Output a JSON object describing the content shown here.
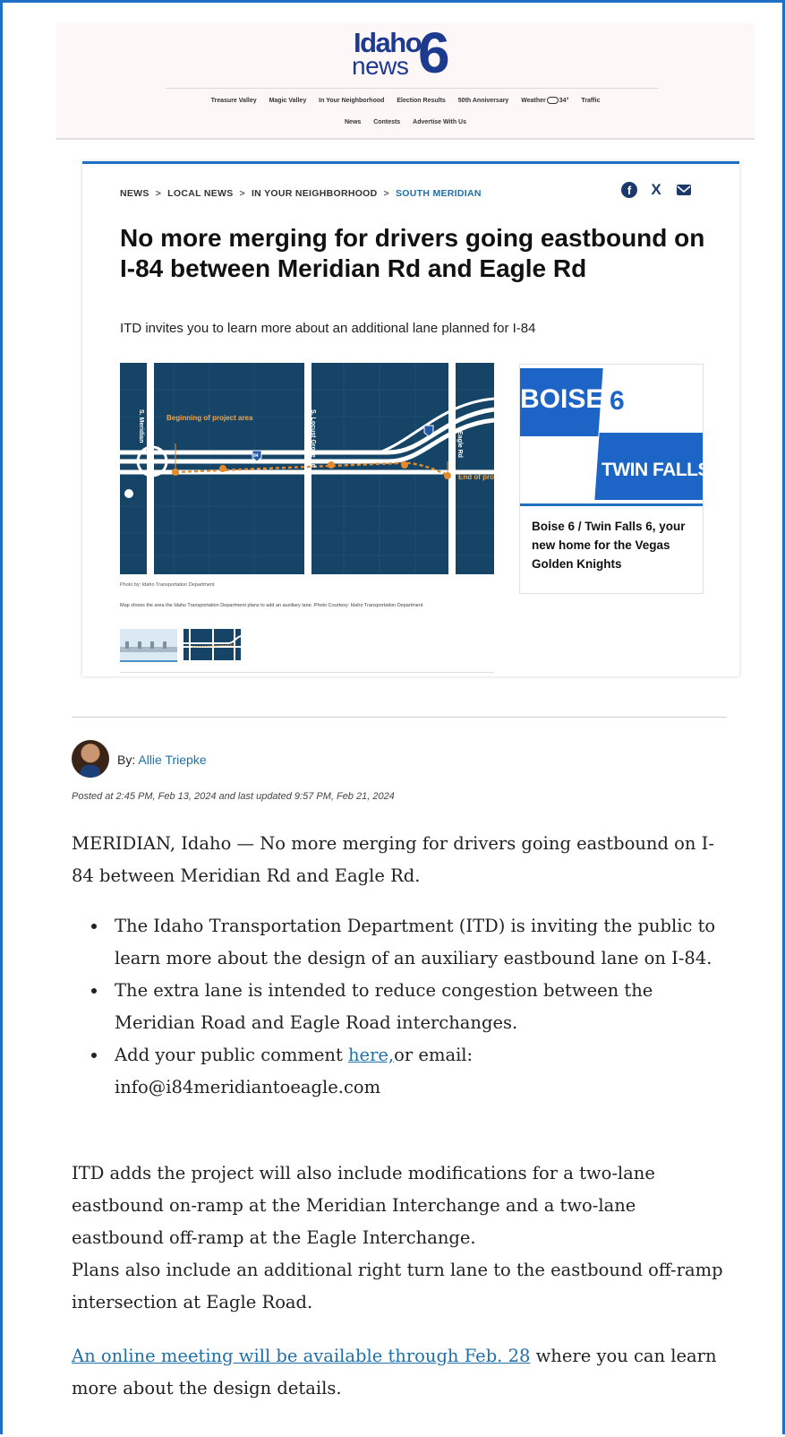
{
  "header": {
    "logo_idaho": "Idaho",
    "logo_news": "news",
    "logo_number": "6",
    "nav_row1": [
      "Treasure Valley",
      "Magic Valley",
      "In Your Neighborhood",
      "Election Results",
      "50th Anniversary"
    ],
    "weather_label": "Weather",
    "weather_temp": "34°",
    "traffic_label": "Traffic",
    "nav_row2": [
      "News",
      "Contests",
      "Advertise With Us"
    ]
  },
  "breadcrumb": [
    "NEWS",
    "LOCAL NEWS",
    "IN YOUR NEIGHBORHOOD",
    "SOUTH MERIDIAN"
  ],
  "share": {
    "facebook": "f",
    "x": "X"
  },
  "article": {
    "headline": "No more merging for drivers going eastbound on I-84 between Meridian Rd and Eagle Rd",
    "subhead": "ITD invites you to learn more about an additional lane planned for I-84",
    "map_labels": {
      "meridian": "S. Meridian",
      "beginning": "Beginning of project area",
      "locust": "S. Locust Grove Rd",
      "eagle": "Eagle Rd",
      "end": "End of project area",
      "shield": "84"
    },
    "photo_credit": "Photo by: Idaho Transportation Department",
    "caption": "Map shows the area the Idaho Transportation Department plans to add an auxiliary lane. Photo Courtesy: Idaho Transportation Department"
  },
  "promo": {
    "boise": "BOISE",
    "six": "6",
    "twin_falls": "TWIN FALLS",
    "title": "Boise 6 / Twin Falls 6, your new home for the Vegas Golden Knights"
  },
  "byline": {
    "by": "By:",
    "author": "Allie Triepke",
    "posted": "Posted at 2:45 PM, Feb 13, 2024 and last updated 9:57 PM, Feb 21, 2024"
  },
  "body": {
    "p1": "MERIDIAN, Idaho — No more merging for drivers going eastbound on I-84 between Meridian Rd and Eagle Rd.",
    "bullets": [
      "The Idaho Transportation Department (ITD) is inviting the public to learn more about the design of an auxiliary eastbound lane on I-84.",
      "The extra lane is intended to reduce congestion between the Meridian Road and Eagle Road interchanges."
    ],
    "bullet3_prefix": "Add your public comment ",
    "bullet3_link": "here,",
    "bullet3_suffix": "or email: info@i84meridiantoeagle.com",
    "p2a": "ITD adds the project will also include modifications for a two-lane eastbound on-ramp at the Meridian Interchange and a two-lane eastbound off-ramp at the Eagle Interchange.",
    "p2b": "Plans also include an additional right turn lane to the eastbound off-ramp intersection at Eagle Road.",
    "p3_link": "An online meeting will be available through Feb. 28",
    "p3_suffix": " where you can learn more about the design details."
  }
}
